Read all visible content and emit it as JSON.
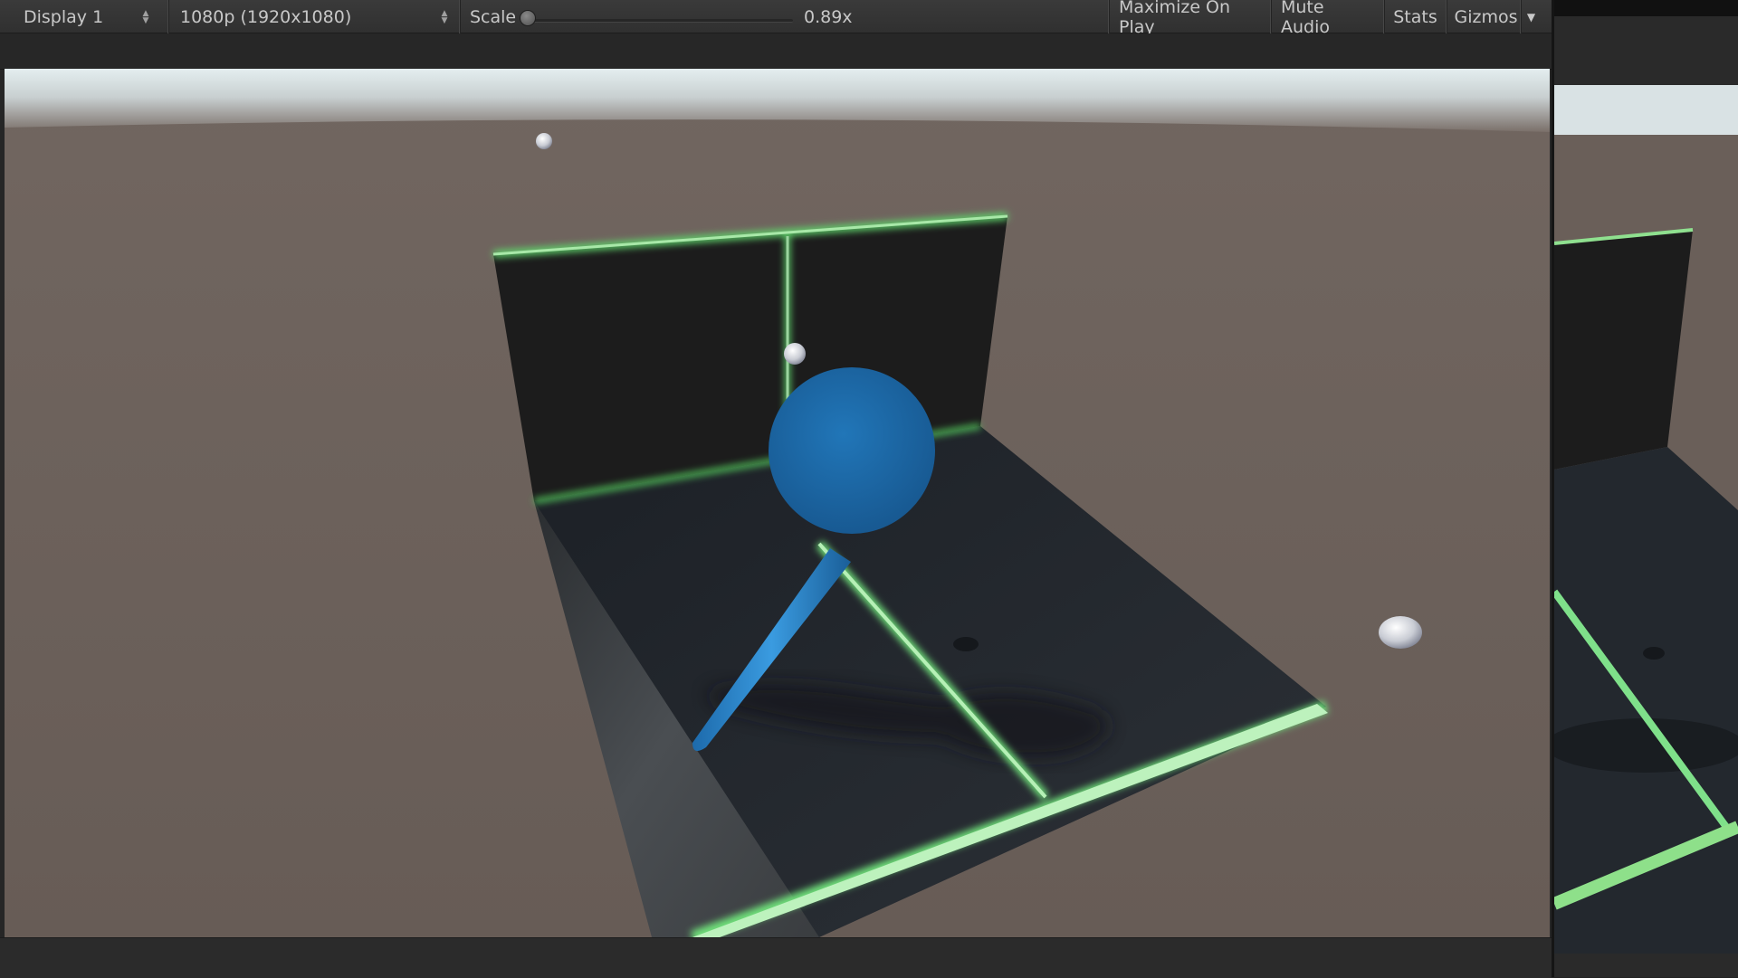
{
  "toolbar": {
    "display_label": "Display 1",
    "resolution_label": "1080p (1920x1080)",
    "scale_label": "Scale",
    "scale_value": "0.89x",
    "scale_fraction": 0.0,
    "maximize_label": "Maximize On Play",
    "mute_label": "Mute Audio",
    "stats_label": "Stats",
    "gizmos_label": "Gizmos"
  },
  "scene": {
    "sky_color": "#dfe8ea",
    "ground_color": "#6a5f59",
    "board_color": "#1f2328",
    "edge_glow_color": "#6fe07a",
    "player_color": "#1e6eb0"
  }
}
